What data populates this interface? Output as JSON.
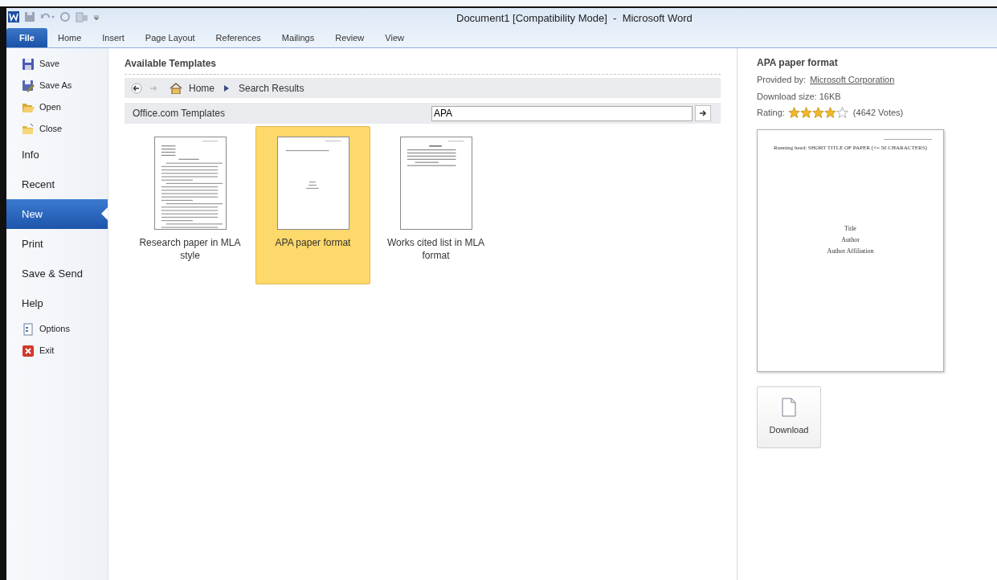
{
  "window": {
    "title": "Document1 [Compatibility Mode]  -  Microsoft Word"
  },
  "ribbon_tabs": [
    {
      "label": "File",
      "selected": true
    },
    {
      "label": "Home",
      "selected": false
    },
    {
      "label": "Insert",
      "selected": false
    },
    {
      "label": "Page Layout",
      "selected": false
    },
    {
      "label": "References",
      "selected": false
    },
    {
      "label": "Mailings",
      "selected": false
    },
    {
      "label": "Review",
      "selected": false
    },
    {
      "label": "View",
      "selected": false
    }
  ],
  "sidebar": {
    "items": [
      {
        "label": "Save",
        "kind": "command",
        "selected": false
      },
      {
        "label": "Save As",
        "kind": "command",
        "selected": false
      },
      {
        "label": "Open",
        "kind": "command",
        "selected": false
      },
      {
        "label": "Close",
        "kind": "command",
        "selected": false
      },
      {
        "label": "Info",
        "kind": "section",
        "selected": false
      },
      {
        "label": "Recent",
        "kind": "section",
        "selected": false
      },
      {
        "label": "New",
        "kind": "section",
        "selected": true
      },
      {
        "label": "Print",
        "kind": "section",
        "selected": false
      },
      {
        "label": "Save & Send",
        "kind": "section",
        "selected": false
      },
      {
        "label": "Help",
        "kind": "section",
        "selected": false
      },
      {
        "label": "Options",
        "kind": "command",
        "selected": false
      },
      {
        "label": "Exit",
        "kind": "command",
        "selected": false
      }
    ]
  },
  "templates": {
    "heading": "Available Templates",
    "breadcrumb": [
      "Home",
      "Search Results"
    ],
    "source": "Office.com Templates",
    "search": {
      "value": "APA"
    },
    "items": [
      {
        "label": "Research paper in MLA style",
        "selected": false
      },
      {
        "label": "APA paper format",
        "selected": true
      },
      {
        "label": "Works cited list in MLA format",
        "selected": false
      }
    ]
  },
  "details": {
    "title": "APA paper format",
    "provider_label": "Provided by:",
    "provider": "Microsoft Corporation",
    "size": "Download size: 16KB",
    "rating_label": "Rating:",
    "stars": 4,
    "votes": "(4642 Votes)",
    "preview": {
      "running_head": "Running head: SHORT TITLE OF PAPER (<= 50 CHARACTERS)",
      "lines": [
        "Title",
        "Author",
        "Author Affiliation"
      ]
    },
    "download": "Download"
  }
}
